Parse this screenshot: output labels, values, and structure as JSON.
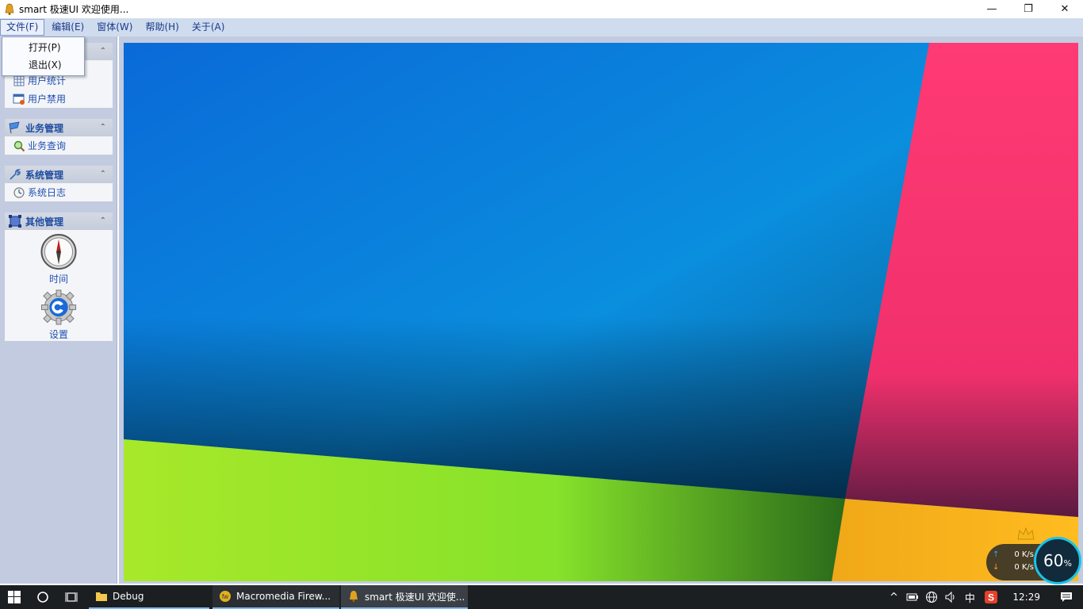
{
  "window": {
    "title": "smart 极速UI 欢迎使用...",
    "min_glyph": "—",
    "max_glyph": "❐",
    "close_glyph": "✕"
  },
  "menu": {
    "items": [
      "文件(F)",
      "编辑(E)",
      "窗体(W)",
      "帮助(H)",
      "关于(A)"
    ],
    "dropdown": [
      "打开(P)",
      "退出(X)"
    ]
  },
  "nav": {
    "groups": [
      {
        "title": "",
        "items": [
          "用户统计",
          "用户禁用"
        ]
      },
      {
        "title": "业务管理",
        "items": [
          "业务查询"
        ]
      },
      {
        "title": "系统管理",
        "items": [
          "系统日志"
        ]
      },
      {
        "title": "其他管理",
        "items": [
          "时间",
          "设置"
        ]
      }
    ],
    "collapse_glyph": "⌃"
  },
  "netwidget": {
    "up": "0 K/s",
    "down": "0 K/s",
    "percent": "60",
    "percent_unit": "%"
  },
  "taskbar": {
    "tasks": [
      "Debug",
      "Macromedia Firew...",
      "smart 极速UI 欢迎使..."
    ],
    "ime": "中",
    "clock": "12:29"
  },
  "colors": {
    "blue": "#0a7fd8",
    "pink": "#ff3a74",
    "green": "#8fe22a",
    "orange": "#ffb41c"
  }
}
